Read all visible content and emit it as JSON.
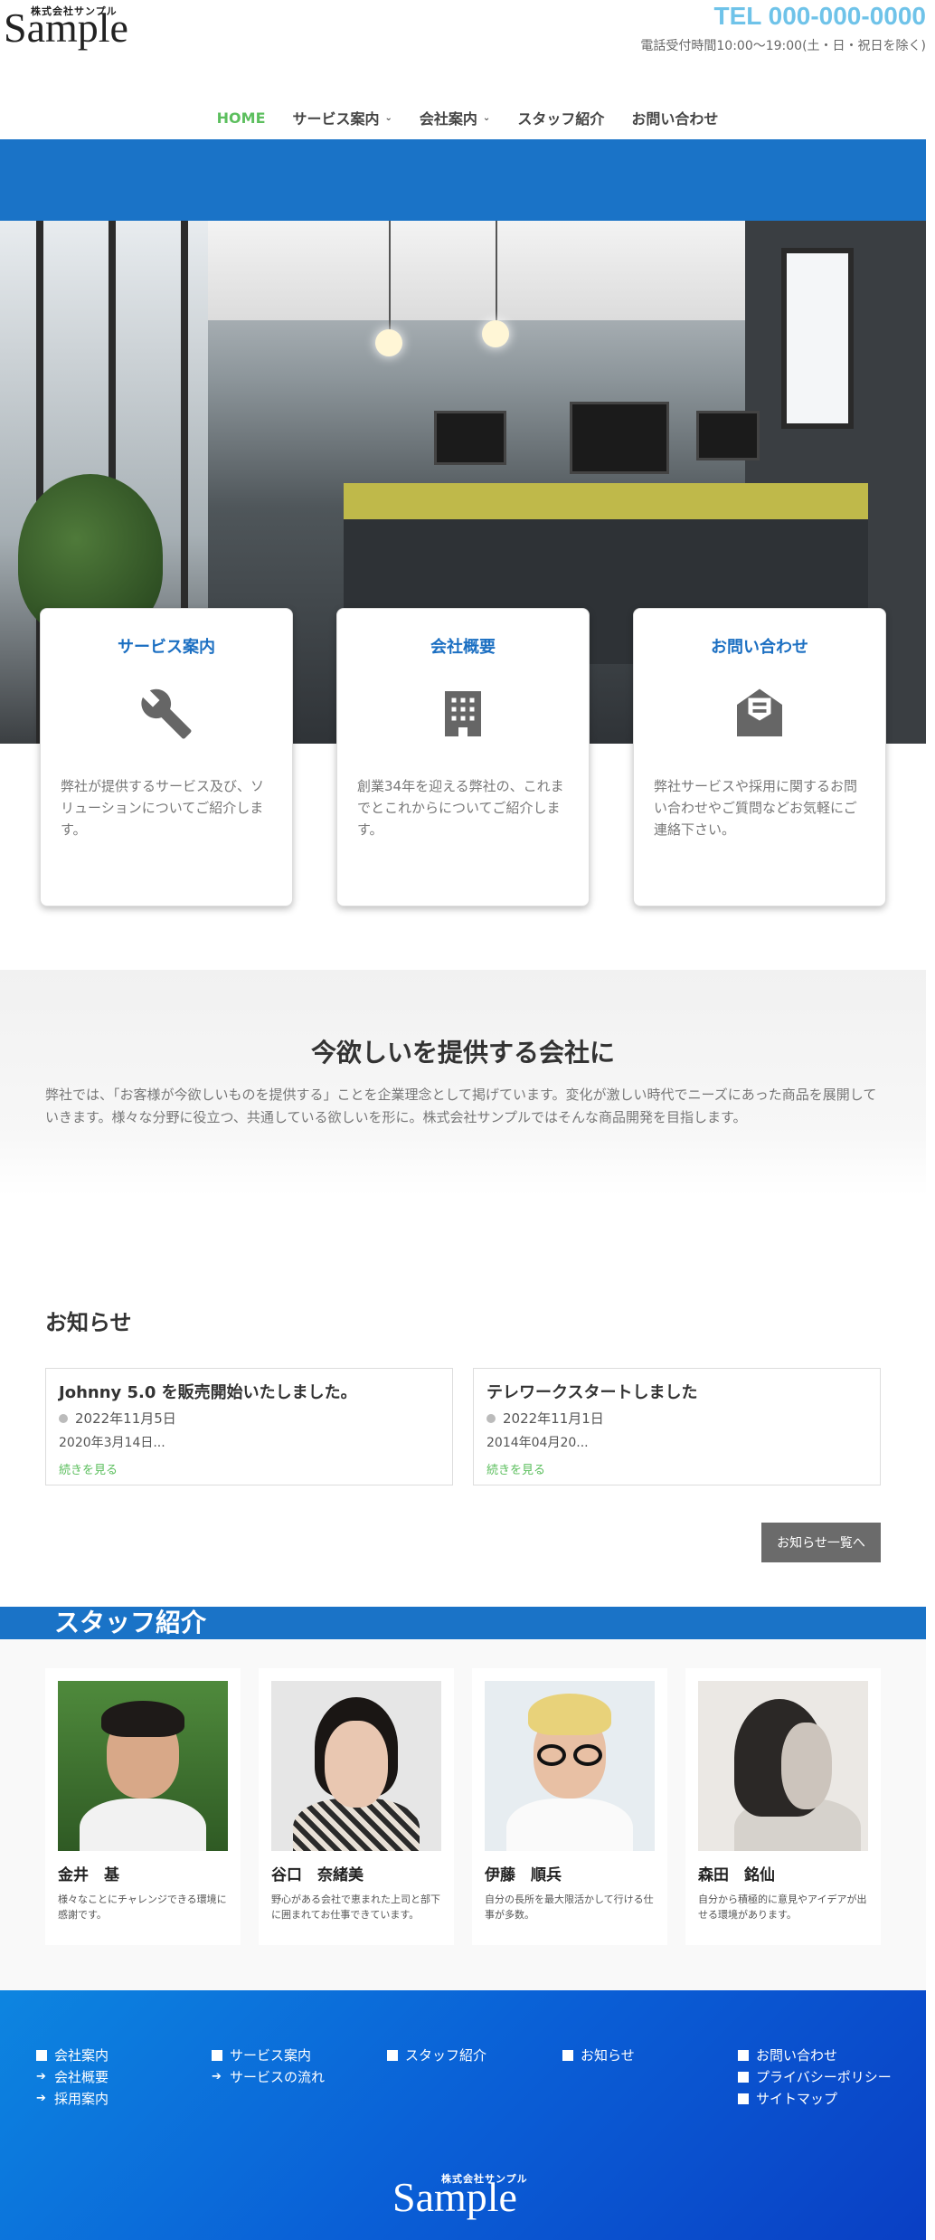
{
  "header": {
    "logo_small": "株式会社サンプル",
    "logo_big": "Sample",
    "tel": "TEL 000-000-0000",
    "hours": "電話受付時間10:00～19:00(土・日・祝日を除く)"
  },
  "nav": [
    {
      "label": "HOME",
      "active": true,
      "dropdown": false
    },
    {
      "label": "サービス案内",
      "active": false,
      "dropdown": true
    },
    {
      "label": "会社案内",
      "active": false,
      "dropdown": true
    },
    {
      "label": "スタッフ紹介",
      "active": false,
      "dropdown": false
    },
    {
      "label": "お問い合わせ",
      "active": false,
      "dropdown": false
    }
  ],
  "cards": [
    {
      "title": "サービス案内",
      "icon": "wrench-icon",
      "text": "弊社が提供するサービス及び、ソリューションについてご紹介します。"
    },
    {
      "title": "会社概要",
      "icon": "building-icon",
      "text": "創業34年を迎える弊社の、これまでとこれからについてご紹介します。"
    },
    {
      "title": "お問い合わせ",
      "icon": "mail-open-icon",
      "text": "弊社サービスや採用に関するお問い合わせやご質問などお気軽にご連絡下さい。"
    }
  ],
  "mission": {
    "title": "今欲しいを提供する会社に",
    "text": "弊社では、「お客様が今欲しいものを提供する」ことを企業理念として掲げています。変化が激しい時代でニーズにあった商品を展開していきます。様々な分野に役立つ、共通している欲しいを形に。株式会社サンプルではそんな商品開発を目指します。"
  },
  "news": {
    "title": "お知らせ",
    "items": [
      {
        "title": "Johnny 5.0 を販売開始いたしました。",
        "date": "2022年11月5日",
        "excerpt": "2020年3月14日...",
        "more": "続きを見る"
      },
      {
        "title": "テレワークスタートしました",
        "date": "2022年11月1日",
        "excerpt": "2014年04月20...",
        "more": "続きを見る"
      }
    ],
    "list_button": "お知らせ一覧へ"
  },
  "staff": {
    "title": "スタッフ紹介",
    "members": [
      {
        "name": "金井　基",
        "desc": "様々なことにチャレンジできる環境に感謝です。"
      },
      {
        "name": "谷口　奈緒美",
        "desc": "野心がある会社で恵まれた上司と部下に囲まれてお仕事できています。"
      },
      {
        "name": "伊藤　順兵",
        "desc": "自分の長所を最大限活かして行ける仕事が多数。"
      },
      {
        "name": "森田　銘仙",
        "desc": "自分から積極的に意見やアイデアが出せる環境があります。"
      }
    ]
  },
  "footer": {
    "columns": [
      [
        {
          "label": "会社案内",
          "type": "square"
        },
        {
          "label": "会社概要",
          "type": "arrow"
        },
        {
          "label": "採用案内",
          "type": "arrow"
        }
      ],
      [
        {
          "label": "サービス案内",
          "type": "square"
        },
        {
          "label": "サービスの流れ",
          "type": "arrow"
        }
      ],
      [
        {
          "label": "スタッフ紹介",
          "type": "square"
        }
      ],
      [
        {
          "label": "お知らせ",
          "type": "square"
        }
      ],
      [
        {
          "label": "お問い合わせ",
          "type": "square"
        },
        {
          "label": "プライバシーポリシー",
          "type": "square"
        },
        {
          "label": "サイトマップ",
          "type": "square"
        }
      ]
    ],
    "logo_small": "株式会社サンプル",
    "logo_big": "Sample"
  },
  "colors": {
    "brand_blue": "#1a73c7",
    "tel_blue": "#6fc3e9",
    "active_green": "#5cbf5e"
  }
}
